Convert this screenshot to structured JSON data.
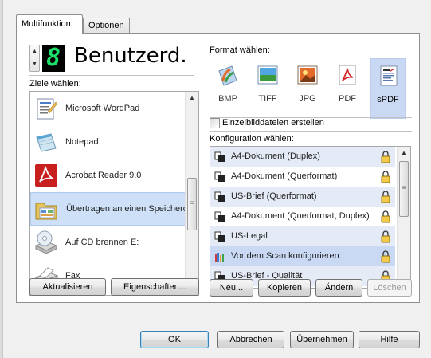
{
  "tabs": [
    {
      "label": "Multifunktion",
      "active": true
    },
    {
      "label": "Optionen",
      "active": false
    }
  ],
  "profile": {
    "number": "8",
    "name": "Benutzerd."
  },
  "destinations": {
    "label": "Ziele wählen:",
    "items": [
      {
        "label": "Microsoft WordPad",
        "icon": "wordpad-icon"
      },
      {
        "label": "Notepad",
        "icon": "notepad-icon"
      },
      {
        "label": "Acrobat Reader 9.0",
        "icon": "acrobat-icon"
      },
      {
        "label": "Übertragen an einen Speicherort",
        "icon": "folder-icon",
        "selected": true
      },
      {
        "label": "Auf CD brennen  E:",
        "icon": "cd-drive-icon"
      },
      {
        "label": "Fax",
        "icon": "fax-icon"
      }
    ]
  },
  "format": {
    "label": "Format wählen:",
    "items": [
      {
        "label": "BMP",
        "icon": "bmp-icon"
      },
      {
        "label": "TIFF",
        "icon": "tiff-icon"
      },
      {
        "label": "JPG",
        "icon": "jpg-icon"
      },
      {
        "label": "PDF",
        "icon": "pdf-icon"
      },
      {
        "label": "sPDF",
        "icon": "spdf-icon",
        "selected": true
      }
    ],
    "single_files_label": "Einzelbilddateien erstellen",
    "single_files_checked": false
  },
  "configuration": {
    "label": "Konfiguration wählen:",
    "items": [
      {
        "label": "A4-Dokument (Duplex)",
        "icon": "scan-icon"
      },
      {
        "label": "A4-Dokument (Querformat)",
        "icon": "scan-icon"
      },
      {
        "label": "US-Brief (Querformat)",
        "icon": "scan-icon"
      },
      {
        "label": "A4-Dokument (Querformat, Duplex)",
        "icon": "scan-icon"
      },
      {
        "label": "US-Legal",
        "icon": "scan-icon"
      },
      {
        "label": "Vor dem Scan konfigurieren",
        "icon": "configure-before-scan-icon",
        "selected": true
      },
      {
        "label": "US-Brief - Qualität",
        "icon": "scan-icon"
      }
    ]
  },
  "left_buttons": {
    "refresh": "Aktualisieren",
    "properties": "Eigenschaften..."
  },
  "config_buttons": {
    "new": "Neu...",
    "copy": "Kopieren",
    "edit": "Ändern",
    "delete": "Löschen"
  },
  "dialog_buttons": {
    "ok": "OK",
    "cancel": "Abbrechen",
    "apply": "Übernehmen",
    "help": "Hilfe"
  },
  "colors": {
    "selection": "#cde0f8",
    "alt_row": "#e4ebf6",
    "digit": "#1de06a"
  }
}
